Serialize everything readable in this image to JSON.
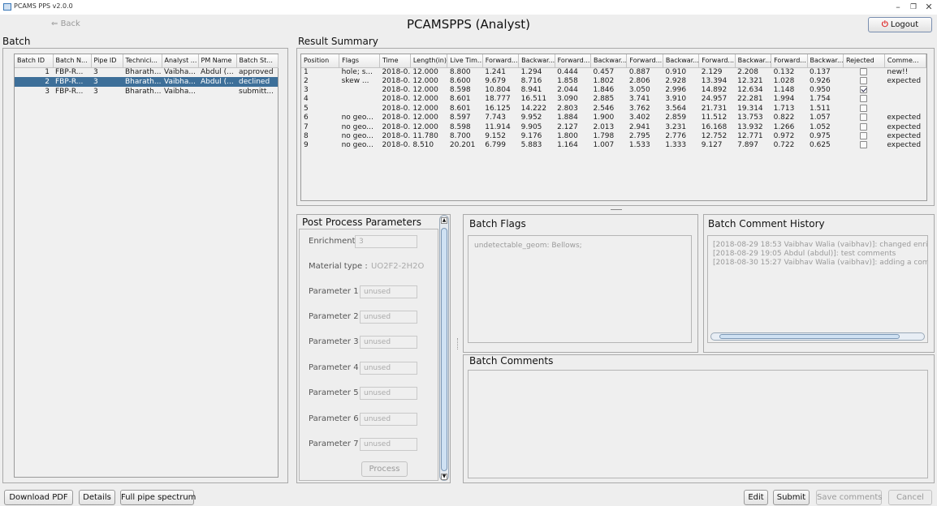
{
  "window": {
    "title": "PCAMS PPS v2.0.0"
  },
  "toolbar": {
    "back_label": "Back",
    "app_title": "PCAMSPPS (Analyst)",
    "logout_label": "Logout"
  },
  "batch": {
    "title": "Batch",
    "columns": [
      "Batch ID",
      "Batch N...",
      "Pipe ID",
      "Technici...",
      "Analyst ...",
      "PM Name",
      "Batch St..."
    ],
    "rows": [
      {
        "id": "1",
        "name": "FBP-R...",
        "pipe": "3",
        "tech": "Bharath...",
        "analyst": "Vaibha...",
        "pm": "Abdul (...",
        "status": "approved",
        "selected": false
      },
      {
        "id": "2",
        "name": "FBP-R...",
        "pipe": "3",
        "tech": "Bharath...",
        "analyst": "Vaibha...",
        "pm": "Abdul (...",
        "status": "declined",
        "selected": true
      },
      {
        "id": "3",
        "name": "FBP-R...",
        "pipe": "3",
        "tech": "Bharath...",
        "analyst": "Vaibha...",
        "pm": "",
        "status": "submitt...",
        "selected": false
      }
    ]
  },
  "results": {
    "title": "Result Summary",
    "columns": [
      "Position",
      "Flags",
      "Time",
      "Length(in)",
      "Live Tim...",
      "Forward...",
      "Backwar...",
      "Forward...",
      "Backwar...",
      "Forward...",
      "Backwar...",
      "Forward...",
      "Backwar...",
      "Forward...",
      "Backwar...",
      "Rejected",
      "Comme..."
    ],
    "rows": [
      [
        "1",
        "hole; s...",
        "2018-0...",
        "12.000",
        "8.800",
        "1.241",
        "1.294",
        "0.444",
        "0.457",
        "0.887",
        "0.910",
        "2.129",
        "2.208",
        "0.132",
        "0.137",
        false,
        "new!!"
      ],
      [
        "2",
        "skew ...",
        "2018-0...",
        "12.000",
        "8.600",
        "9.679",
        "8.716",
        "1.858",
        "1.802",
        "2.806",
        "2.928",
        "13.394",
        "12.321",
        "1.028",
        "0.926",
        false,
        "expected"
      ],
      [
        "3",
        "",
        "2018-0...",
        "12.000",
        "8.598",
        "10.804",
        "8.941",
        "2.044",
        "1.846",
        "3.050",
        "2.996",
        "14.892",
        "12.634",
        "1.148",
        "0.950",
        true,
        ""
      ],
      [
        "4",
        "",
        "2018-0...",
        "12.000",
        "8.601",
        "18.777",
        "16.511",
        "3.090",
        "2.885",
        "3.741",
        "3.910",
        "24.957",
        "22.281",
        "1.994",
        "1.754",
        false,
        ""
      ],
      [
        "5",
        "",
        "2018-0...",
        "12.000",
        "8.601",
        "16.125",
        "14.222",
        "2.803",
        "2.546",
        "3.762",
        "3.564",
        "21.731",
        "19.314",
        "1.713",
        "1.511",
        false,
        ""
      ],
      [
        "6",
        "no geo...",
        "2018-0...",
        "12.000",
        "8.597",
        "7.743",
        "9.952",
        "1.884",
        "1.900",
        "3.402",
        "2.859",
        "11.512",
        "13.753",
        "0.822",
        "1.057",
        false,
        "expected"
      ],
      [
        "7",
        "no geo...",
        "2018-0...",
        "12.000",
        "8.598",
        "11.914",
        "9.905",
        "2.127",
        "2.013",
        "2.941",
        "3.231",
        "16.168",
        "13.932",
        "1.266",
        "1.052",
        false,
        "expected"
      ],
      [
        "8",
        "no geo...",
        "2018-0...",
        "11.780",
        "8.700",
        "9.152",
        "9.176",
        "1.800",
        "1.798",
        "2.795",
        "2.776",
        "12.752",
        "12.771",
        "0.972",
        "0.975",
        false,
        "expected"
      ],
      [
        "9",
        "no geo...",
        "2018-0...",
        "8.510",
        "20.201",
        "6.799",
        "5.883",
        "1.164",
        "1.007",
        "1.533",
        "1.333",
        "9.127",
        "7.897",
        "0.722",
        "0.625",
        false,
        "expected"
      ]
    ]
  },
  "post_process": {
    "title": "Post Process Parameters",
    "enrichment_label": "Enrichment :",
    "enrichment_value": "3",
    "material_label": "Material type :",
    "material_value": "UO2F2-2H2O",
    "params": [
      {
        "label": "Parameter 1 :",
        "value": "unused"
      },
      {
        "label": "Parameter 2 :",
        "value": "unused"
      },
      {
        "label": "Parameter 3 :",
        "value": "unused"
      },
      {
        "label": "Parameter 4 :",
        "value": "unused"
      },
      {
        "label": "Parameter 5 :",
        "value": "unused"
      },
      {
        "label": "Parameter 6 :",
        "value": "unused"
      },
      {
        "label": "Parameter 7 :",
        "value": "unused"
      }
    ],
    "process_label": "Process"
  },
  "batch_flags": {
    "title": "Batch Flags",
    "text": "undetectable_geom: Bellows;"
  },
  "comment_history": {
    "title": "Batch Comment History",
    "lines": [
      "[2018-08-29 18:53 Vaibhav Walia (vaibhav)]: changed enrichm",
      "[2018-08-29 19:05 Abdul (abdul)]: test comments",
      "[2018-08-30 15:27 Vaibhav Walia (vaibhav)]: adding a commen"
    ]
  },
  "batch_comments": {
    "title": "Batch Comments"
  },
  "footer": {
    "download_pdf": "Download PDF",
    "details": "Details",
    "full_pipe": "Full pipe spectrum",
    "edit": "Edit",
    "submit": "Submit",
    "save_comments": "Save comments",
    "cancel": "Cancel"
  }
}
